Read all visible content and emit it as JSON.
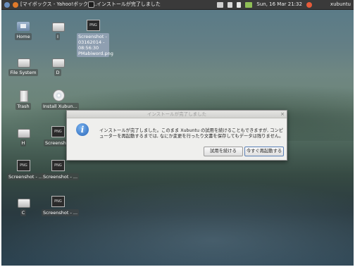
{
  "panel": {
    "tasks": [
      {
        "label": "[マイボックス - Yahoo!ボックス..."
      },
      {
        "label": "インストールが完了しました"
      }
    ],
    "clock": "Sun, 16 Mar 21:32",
    "user": "xubuntu",
    "colors": {
      "panel": "#3a3a3a"
    }
  },
  "desktop": {
    "icons": [
      {
        "label": "Home"
      },
      {
        "label": "I"
      },
      {
        "label": "Screenshot - 03162014 - 08:56:30 PMabiword.png"
      },
      {
        "label": "File System"
      },
      {
        "label": "D"
      },
      {
        "label": "Trash"
      },
      {
        "label": "Install Xubun..."
      },
      {
        "label": "H"
      },
      {
        "label": "Screensh..."
      },
      {
        "label": "Screenshot - ..."
      },
      {
        "label": "Screenshot - ..."
      },
      {
        "label": "C"
      },
      {
        "label": "Screenshot - ..."
      }
    ],
    "png_badge": "PNG"
  },
  "dialog": {
    "title": "インストールが完了しました",
    "message": "インストールが完了しました。このまま Xubuntu の試用を続けることもできますが, コンピューターを再起動するまでは, なにか変更を行ったり文書を保存してもデータは残りません。",
    "continue_label": "試用を続ける",
    "restart_label": "今すぐ再起動する",
    "close_label": "×",
    "icon_glyph": "i"
  }
}
